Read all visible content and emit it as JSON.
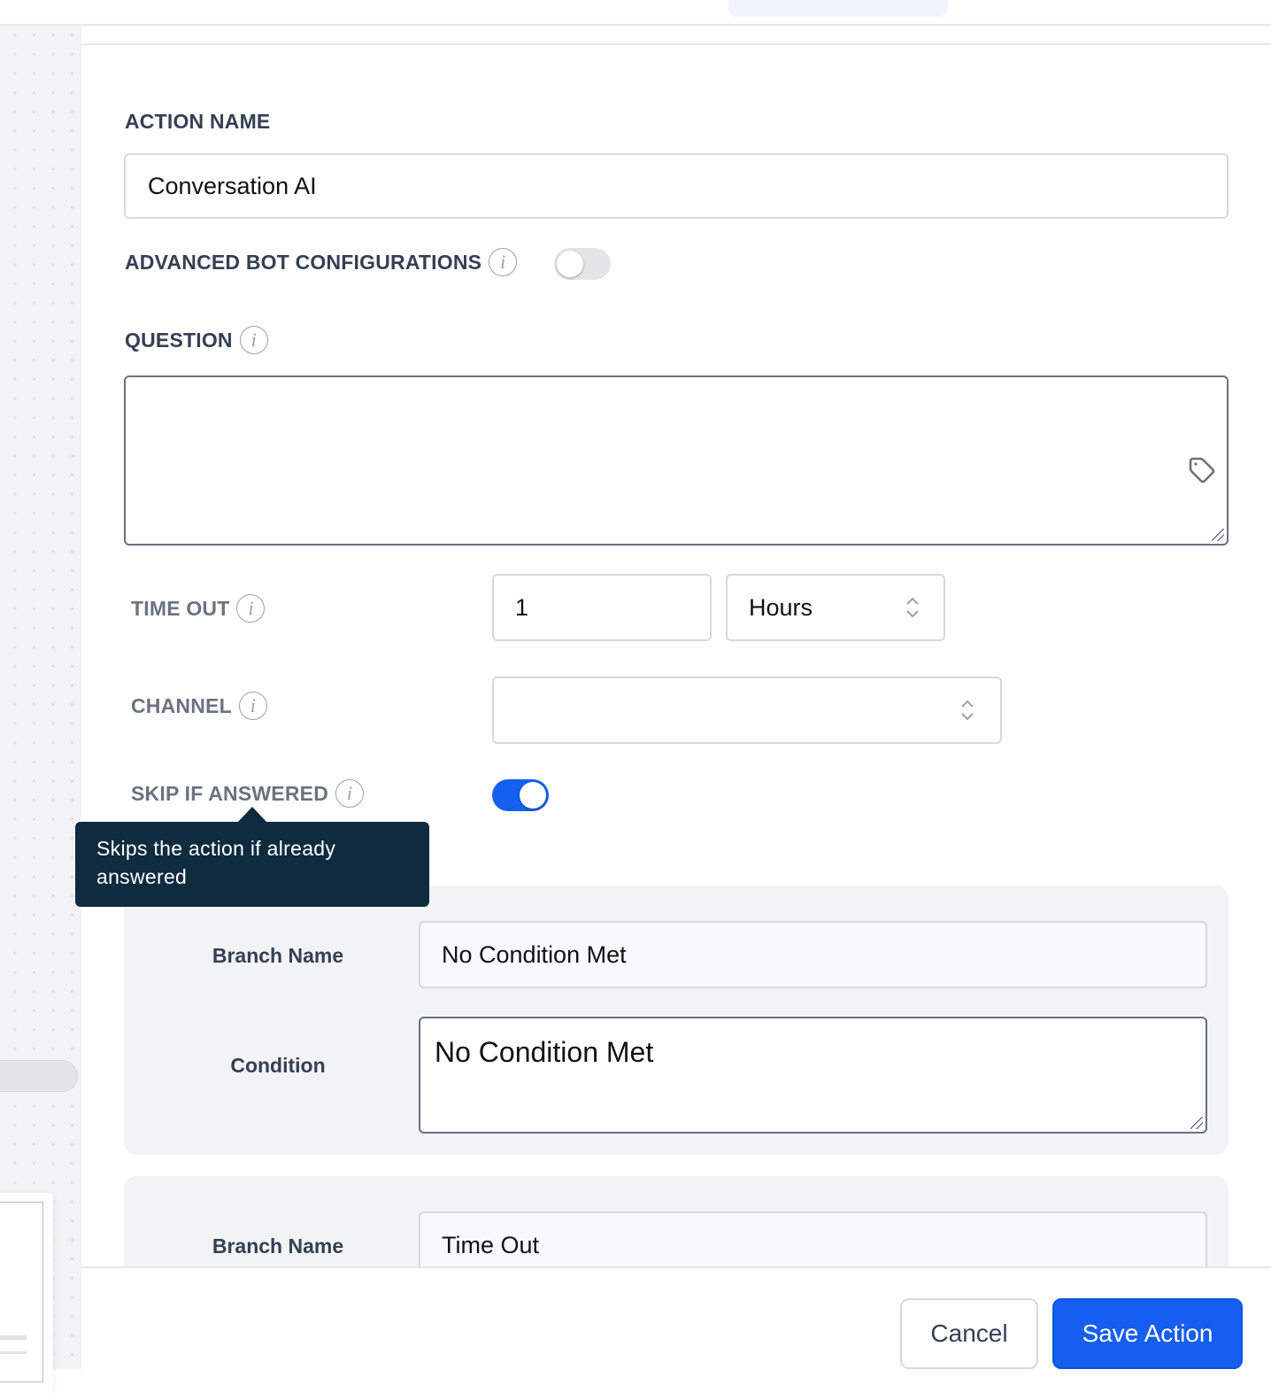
{
  "form": {
    "action_name": {
      "label": "ACTION NAME",
      "value": "Conversation AI"
    },
    "advanced_bot": {
      "label": "ADVANCED BOT CONFIGURATIONS",
      "enabled": false
    },
    "question": {
      "label": "QUESTION",
      "value": ""
    },
    "timeout": {
      "label": "TIME OUT",
      "value": "1",
      "unit": "Hours"
    },
    "channel": {
      "label": "CHANNEL",
      "value": ""
    },
    "skip_if_answered": {
      "label": "SKIP IF ANSWERED",
      "enabled": true,
      "tooltip": "Skips the action if already answered"
    }
  },
  "branches": [
    {
      "branch_name_label": "Branch Name",
      "branch_name": "No Condition Met",
      "condition_label": "Condition",
      "condition": "No Condition Met"
    },
    {
      "branch_name_label": "Branch Name",
      "branch_name": "Time Out"
    }
  ],
  "footer": {
    "cancel_label": "Cancel",
    "save_label": "Save Action"
  },
  "icons": {
    "info": "i"
  },
  "colors": {
    "accent": "#155eef",
    "tooltip_bg": "#0e2b40",
    "label": "#344054"
  }
}
